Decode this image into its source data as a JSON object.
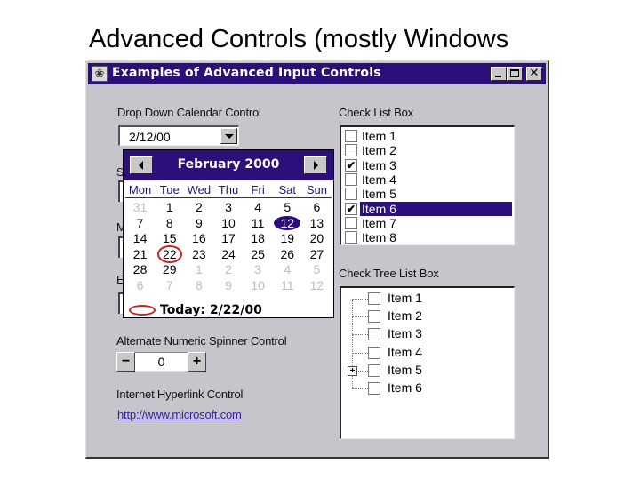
{
  "slide": {
    "title": "Advanced Controls (mostly Windows"
  },
  "window": {
    "title": "Examples of Advanced Input Controls",
    "icon": "app-icon",
    "buttons": {
      "minimize": "_",
      "maximize": "□",
      "close": "✕"
    }
  },
  "calendar_control": {
    "label": "Drop Down Calendar Control",
    "value": "2/12/00",
    "dropdown_icon": "triangle-down-icon",
    "popup": {
      "month_label": "February 2000",
      "prev_icon": "triangle-left-icon",
      "next_icon": "triangle-right-icon",
      "weekdays": [
        "Mon",
        "Tue",
        "Wed",
        "Thu",
        "Fri",
        "Sat",
        "Sun"
      ],
      "weeks": [
        [
          {
            "d": "31",
            "other": true
          },
          {
            "d": "1"
          },
          {
            "d": "2"
          },
          {
            "d": "3"
          },
          {
            "d": "4"
          },
          {
            "d": "5"
          },
          {
            "d": "6"
          }
        ],
        [
          {
            "d": "7"
          },
          {
            "d": "8"
          },
          {
            "d": "9"
          },
          {
            "d": "10"
          },
          {
            "d": "11"
          },
          {
            "d": "12",
            "selected": true
          },
          {
            "d": "13"
          }
        ],
        [
          {
            "d": "14"
          },
          {
            "d": "15"
          },
          {
            "d": "16"
          },
          {
            "d": "17"
          },
          {
            "d": "18"
          },
          {
            "d": "19"
          },
          {
            "d": "20"
          }
        ],
        [
          {
            "d": "21"
          },
          {
            "d": "22",
            "today": true
          },
          {
            "d": "23"
          },
          {
            "d": "24"
          },
          {
            "d": "25"
          },
          {
            "d": "26"
          },
          {
            "d": "27"
          }
        ],
        [
          {
            "d": "28"
          },
          {
            "d": "29"
          },
          {
            "d": "1",
            "other": true
          },
          {
            "d": "2",
            "other": true
          },
          {
            "d": "3",
            "other": true
          },
          {
            "d": "4",
            "other": true
          },
          {
            "d": "5",
            "other": true
          }
        ],
        [
          {
            "d": "6",
            "other": true
          },
          {
            "d": "7",
            "other": true
          },
          {
            "d": "8",
            "other": true
          },
          {
            "d": "9",
            "other": true
          },
          {
            "d": "10",
            "other": true
          },
          {
            "d": "11",
            "other": true
          },
          {
            "d": "12",
            "other": true
          }
        ]
      ],
      "today_label": "Today: 2/22/00"
    }
  },
  "hidden_labels": [
    "S",
    "M",
    "E"
  ],
  "spinner": {
    "label": "Alternate Numeric Spinner Control",
    "value": "0",
    "decrement": "−",
    "increment": "+"
  },
  "hyperlink": {
    "label": "Internet Hyperlink Control",
    "text": "http://www.microsoft.com"
  },
  "check_list": {
    "label": "Check List Box",
    "items": [
      {
        "label": "Item 1",
        "checked": false,
        "selected": false
      },
      {
        "label": "Item 2",
        "checked": false,
        "selected": false
      },
      {
        "label": "Item 3",
        "checked": true,
        "selected": false
      },
      {
        "label": "Item 4",
        "checked": false,
        "selected": false
      },
      {
        "label": "Item 5",
        "checked": false,
        "selected": false
      },
      {
        "label": "Item 6",
        "checked": true,
        "selected": true
      },
      {
        "label": "Item 7",
        "checked": false,
        "selected": false
      },
      {
        "label": "Item 8",
        "checked": false,
        "selected": false
      }
    ]
  },
  "check_tree": {
    "label": "Check Tree List Box",
    "items": [
      {
        "label": "Item 1",
        "checked": false,
        "expandable": false
      },
      {
        "label": "Item 2",
        "checked": false,
        "expandable": false
      },
      {
        "label": "Item 3",
        "checked": false,
        "expandable": false
      },
      {
        "label": "Item 4",
        "checked": false,
        "expandable": false
      },
      {
        "label": "Item 5",
        "checked": false,
        "expandable": true
      },
      {
        "label": "Item 6",
        "checked": false,
        "expandable": false
      }
    ],
    "expander_symbol": "+"
  },
  "colors": {
    "titlebar": "#2d0f7a",
    "window_bg": "#c6c5cc",
    "today_marker": "#cc2222",
    "link": "#3a1f9a"
  }
}
